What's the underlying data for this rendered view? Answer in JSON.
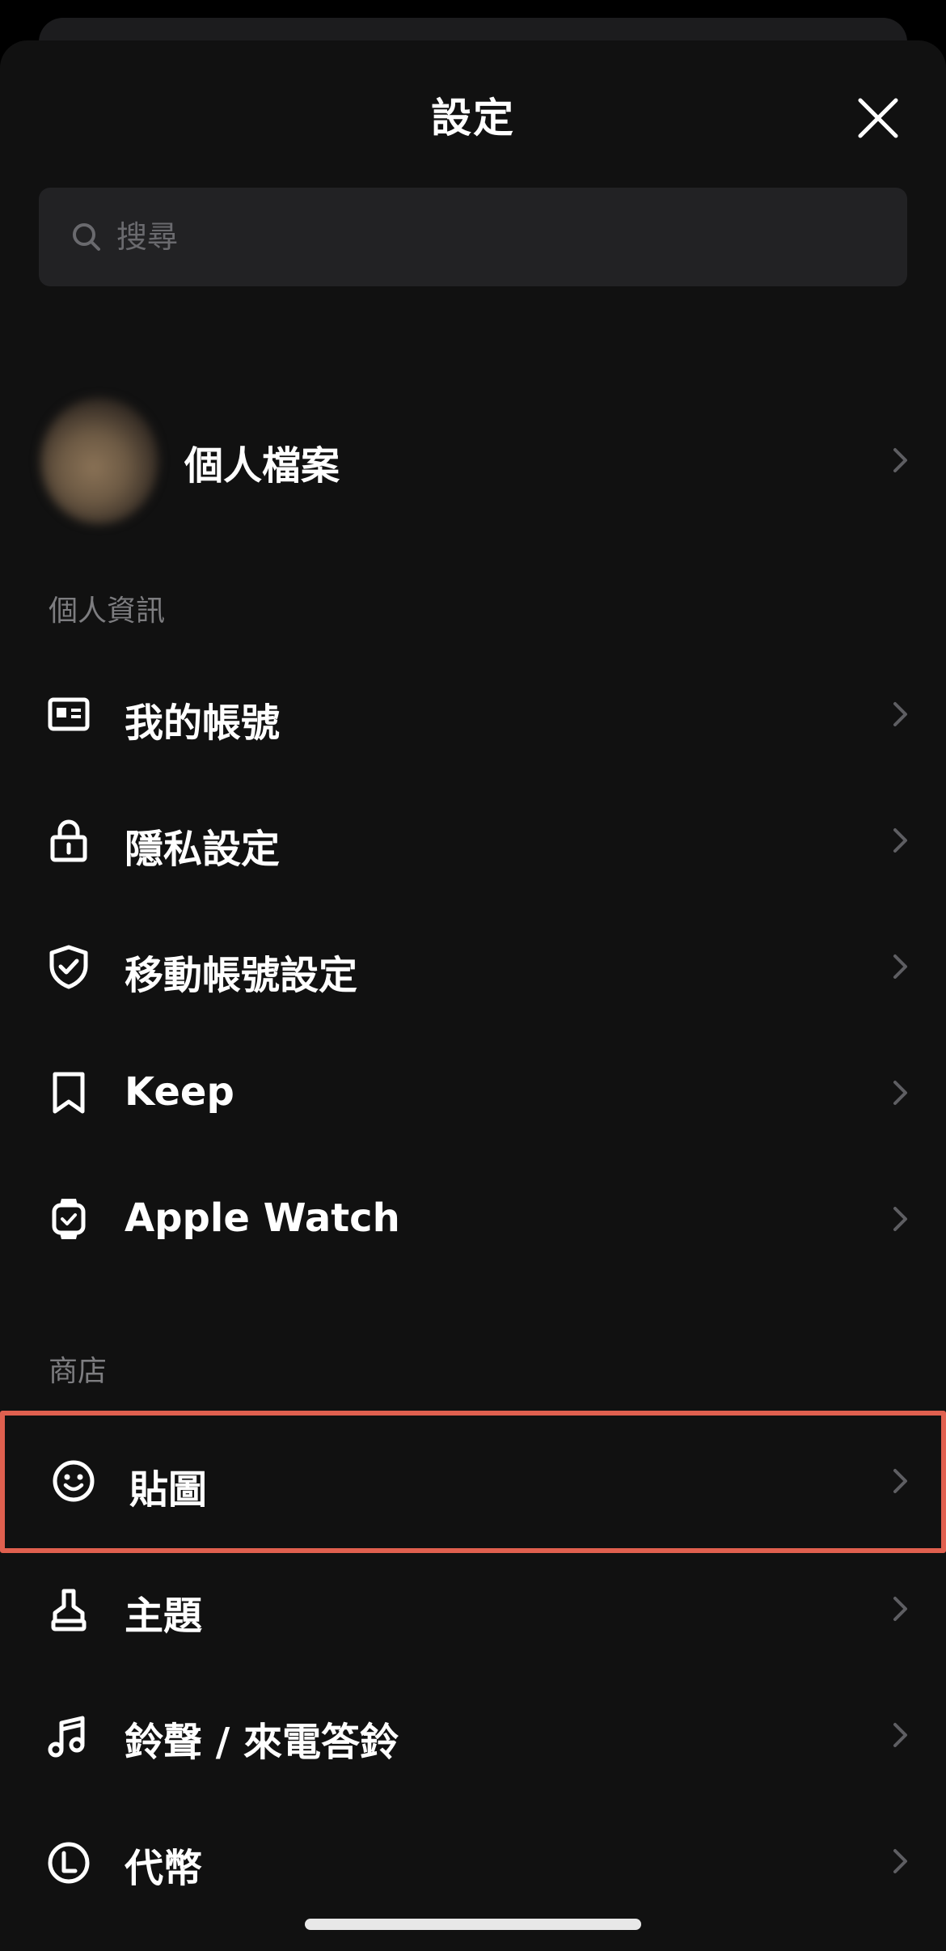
{
  "header": {
    "title": "設定"
  },
  "search": {
    "placeholder": "搜尋"
  },
  "profile": {
    "label": "個人檔案"
  },
  "sections": {
    "personal": {
      "title": "個人資訊",
      "items": [
        {
          "label": "我的帳號",
          "icon": "id-card-icon"
        },
        {
          "label": "隱私設定",
          "icon": "lock-icon"
        },
        {
          "label": "移動帳號設定",
          "icon": "shield-check-icon"
        },
        {
          "label": "Keep",
          "icon": "bookmark-icon"
        },
        {
          "label": "Apple Watch",
          "icon": "watch-icon"
        }
      ]
    },
    "store": {
      "title": "商店",
      "items": [
        {
          "label": "貼圖",
          "icon": "smiley-icon"
        },
        {
          "label": "主題",
          "icon": "brush-icon"
        },
        {
          "label": "鈴聲 / 來電答鈴",
          "icon": "music-note-icon"
        },
        {
          "label": "代幣",
          "icon": "coin-icon"
        }
      ]
    }
  },
  "colors": {
    "sheet": "#111111",
    "search_bg": "#222224",
    "section_title": "#7d7d80",
    "highlight_border": "#e0604f"
  }
}
